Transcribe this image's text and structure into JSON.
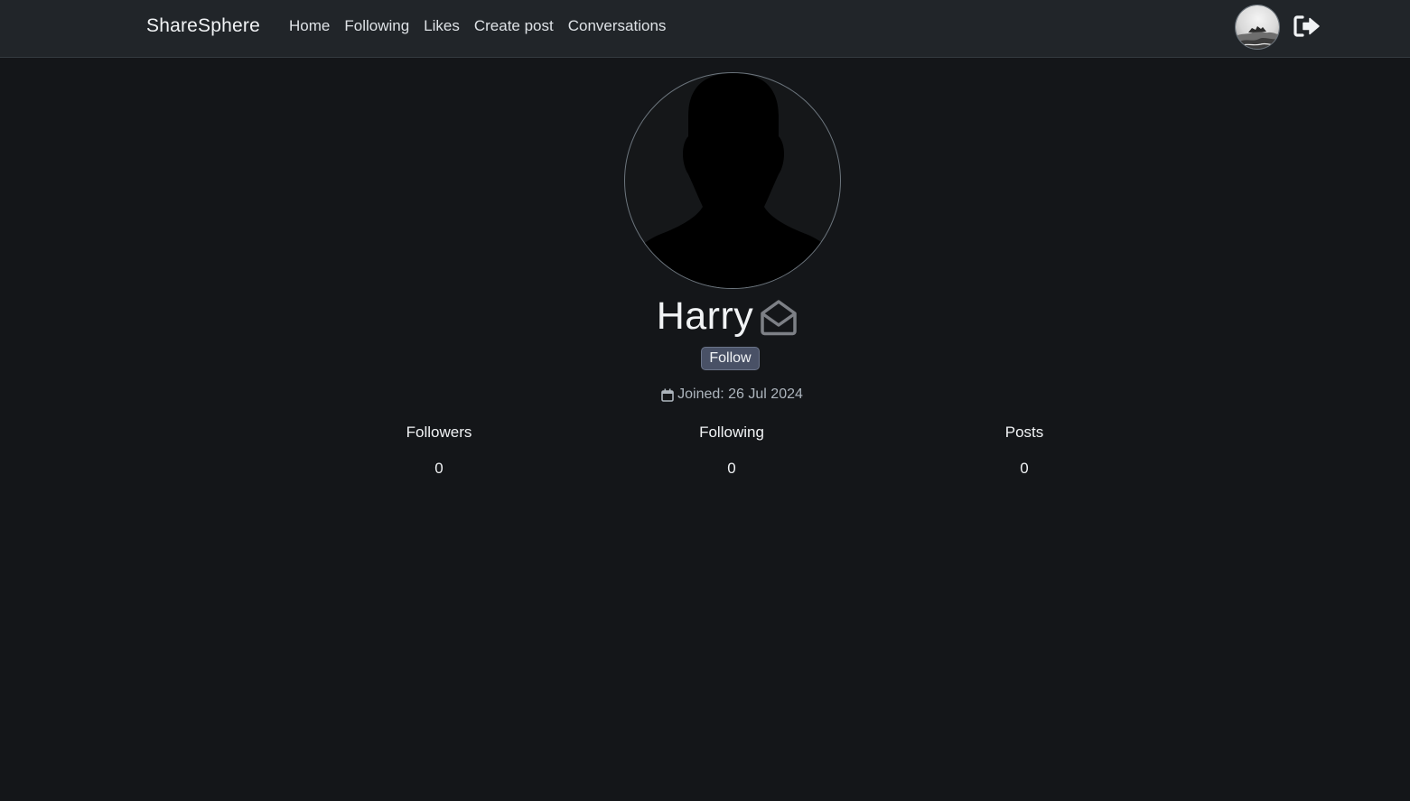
{
  "nav": {
    "brand": "ShareSphere",
    "links": [
      {
        "label": "Home"
      },
      {
        "label": "Following"
      },
      {
        "label": "Likes"
      },
      {
        "label": "Create post"
      },
      {
        "label": "Conversations"
      }
    ],
    "avatar_icon": "user-avatar-image",
    "logout_icon": "sign-out-icon"
  },
  "profile": {
    "avatar_icon": "default-user-silhouette",
    "name": "Harry",
    "message_icon": "envelope-open-icon",
    "follow_label": "Follow",
    "joined_icon": "calendar-icon",
    "joined_text": "Joined: 26 Jul 2024"
  },
  "stats": [
    {
      "label": "Followers",
      "value": "0"
    },
    {
      "label": "Following",
      "value": "0"
    },
    {
      "label": "Posts",
      "value": "0"
    }
  ],
  "colors": {
    "background": "#141619",
    "navbar": "#212529",
    "follow_button": "#495166"
  }
}
